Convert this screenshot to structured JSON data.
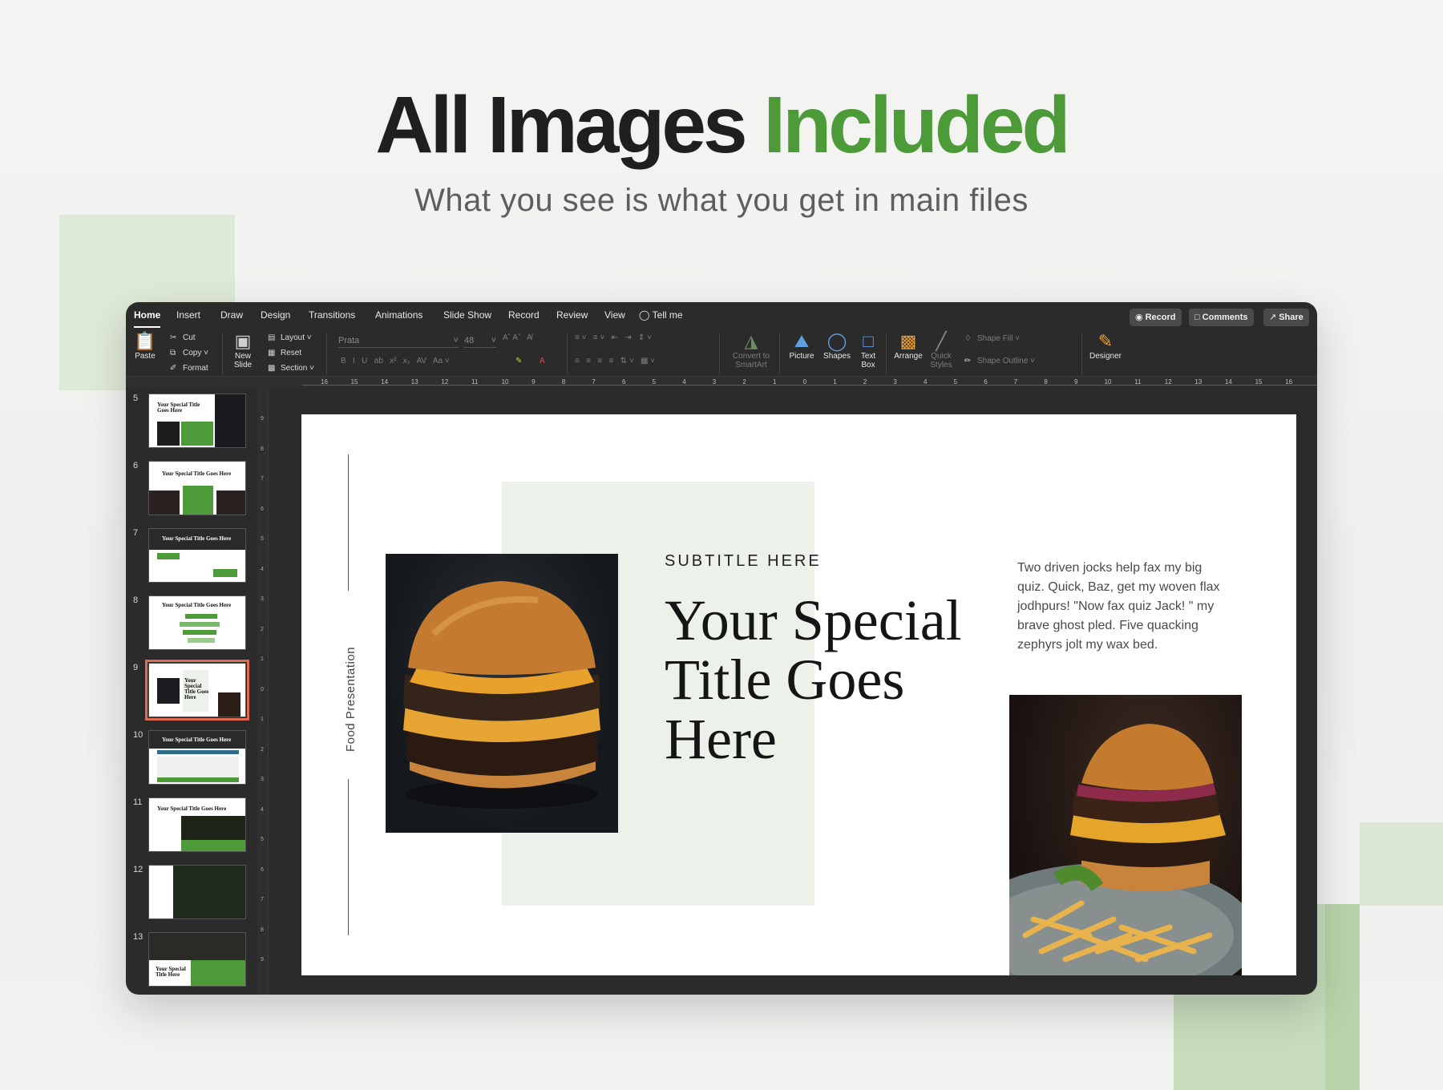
{
  "hero": {
    "title_part1": "All Images",
    "title_part2": "Included",
    "subtitle": "What you see is what you get in main files",
    "accent_color": "#4c9a38"
  },
  "app": {
    "tabs": [
      "Home",
      "Insert",
      "Draw",
      "Design",
      "Transitions",
      "Animations",
      "Slide Show",
      "Record",
      "Review",
      "View"
    ],
    "tell_me": "Tell me",
    "buttons": {
      "record": "Record",
      "comments": "Comments",
      "share": "Share"
    },
    "ribbon": {
      "paste": "Paste",
      "cut": "Cut",
      "copy": "Copy",
      "format": "Format",
      "new_slide_1": "New",
      "new_slide_2": "Slide",
      "layout": "Layout",
      "reset": "Reset",
      "section": "Section",
      "font_name": "Prata",
      "font_size": "48",
      "convert_1": "Convert to",
      "convert_2": "SmartArt",
      "picture": "Picture",
      "shapes": "Shapes",
      "text_box_1": "Text",
      "text_box_2": "Box",
      "arrange": "Arrange",
      "quick_styles_1": "Quick",
      "quick_styles_2": "Styles",
      "shape_fill": "Shape Fill",
      "shape_outline": "Shape Outline",
      "designer": "Designer"
    },
    "ruler_labels": [
      "16",
      "15",
      "14",
      "13",
      "12",
      "11",
      "10",
      "9",
      "8",
      "7",
      "6",
      "5",
      "4",
      "3",
      "2",
      "1",
      "0",
      "1",
      "2",
      "3",
      "4",
      "5",
      "6",
      "7",
      "8",
      "9",
      "10",
      "11",
      "12",
      "13",
      "14",
      "15",
      "16"
    ],
    "vruler_labels": [
      "9",
      "8",
      "7",
      "6",
      "5",
      "4",
      "3",
      "2",
      "1",
      "0",
      "1",
      "2",
      "3",
      "4",
      "5",
      "6",
      "7",
      "8",
      "9"
    ],
    "thumbnails": [
      {
        "num": "5",
        "title": "Your Special Title Goes Here"
      },
      {
        "num": "6",
        "title": "Your Special Title Goes Here"
      },
      {
        "num": "7",
        "title": "Your Special Title Goes Here"
      },
      {
        "num": "8",
        "title": "Your Special Title Goes Here"
      },
      {
        "num": "9",
        "title": "Your Special Title Goes Here",
        "selected": true
      },
      {
        "num": "10",
        "title": "Your Special Title Goes Here"
      },
      {
        "num": "11",
        "title": "Your Special Title Goes Here"
      },
      {
        "num": "12",
        "title": ""
      },
      {
        "num": "13",
        "title": "Your Special Title Here"
      }
    ],
    "selected_slide_border": "#e06a52"
  },
  "slide": {
    "vertical_label": "Food Presentation",
    "subtitle": "SUBTITLE HERE",
    "title": "Your Special Title Goes Here",
    "body": "Two driven jocks help fax my big quiz. Quick, Baz, get my woven flax jodhpurs! \"Now fax quiz Jack! \" my brave ghost pled. Five quacking zephyrs jolt my wax bed.",
    "panel_color": "#ecf2e9",
    "images": [
      "burger-photo",
      "burger-with-fries-photo"
    ]
  }
}
